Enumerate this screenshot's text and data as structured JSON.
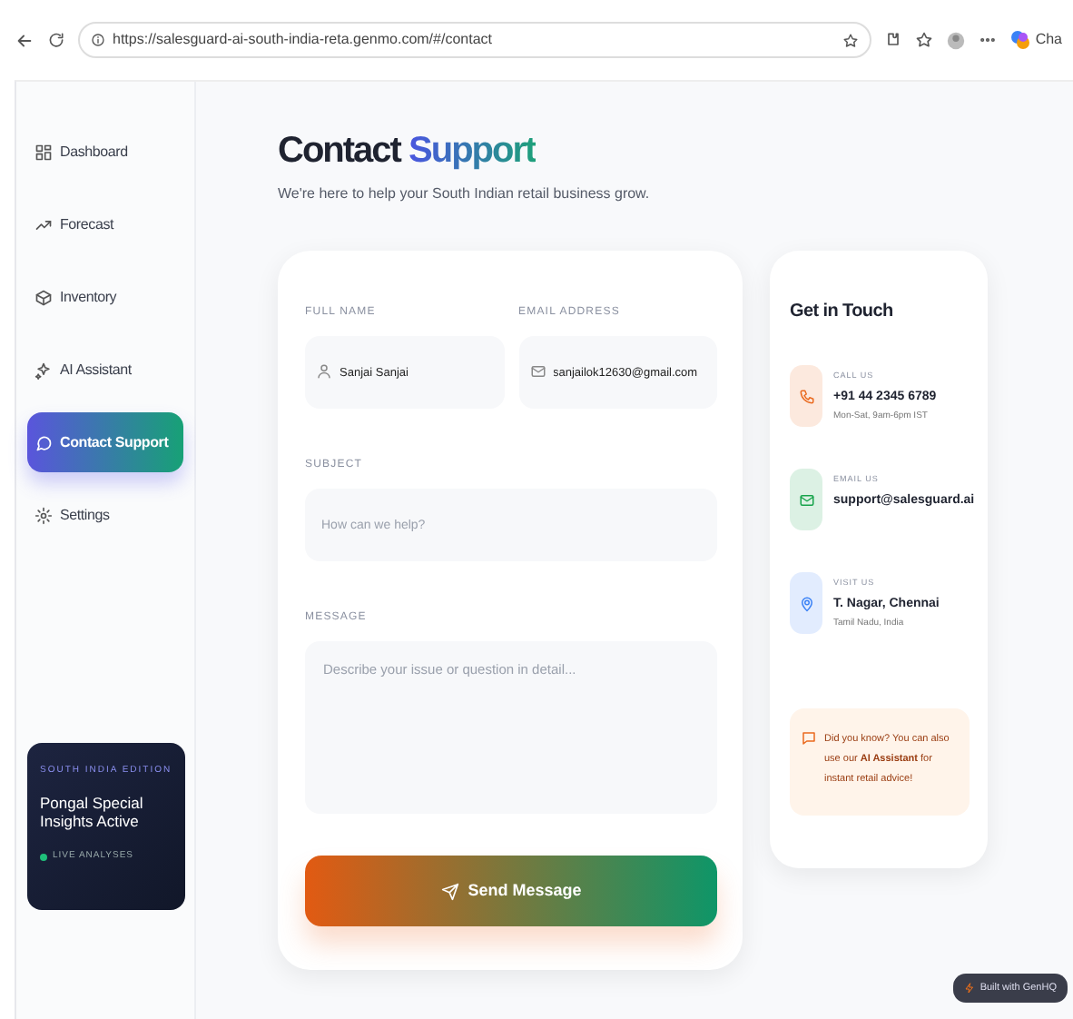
{
  "browser": {
    "url": "https://salesguard-ai-south-india-reta.genmo.com/#/contact",
    "edge_label": "Cha"
  },
  "sidebar": {
    "items": [
      {
        "label": "Dashboard",
        "selected": false
      },
      {
        "label": "Forecast",
        "selected": false
      },
      {
        "label": "Inventory",
        "selected": false
      },
      {
        "label": "AI Assistant",
        "selected": false
      },
      {
        "label": "Contact Support",
        "selected": true
      },
      {
        "label": "Settings",
        "selected": false
      }
    ],
    "promo": {
      "edition": "SOUTH INDIA EDITION",
      "title": "Pongal Special Insights Active",
      "status": "LIVE ANALYSES"
    }
  },
  "header": {
    "title": "Contact",
    "title_accent": "Support",
    "subtitle": "We're here to help your South Indian retail business grow."
  },
  "form": {
    "fields": [
      {
        "label": "FULL NAME",
        "kind": "input",
        "value": "Sanjai Sanjai"
      },
      {
        "label": "EMAIL ADDRESS",
        "kind": "input",
        "value": "sanjailok12630@gmail.com"
      },
      {
        "label": "SUBJECT",
        "kind": "input",
        "placeholder": "How can we help?"
      },
      {
        "label": "MESSAGE",
        "kind": "textarea",
        "placeholder": "Describe your issue or question in detail..."
      }
    ],
    "submit": "Send Message"
  },
  "contact": {
    "title": "Get in Touch",
    "items": [
      {
        "label": "CALL US",
        "value": "+91 44 2345 6789",
        "note": "Mon-Sat, 9am-6pm IST",
        "color": "#ea6a1f"
      },
      {
        "label": "EMAIL US",
        "value": "support@salesguard.ai",
        "color": "#16a34a"
      },
      {
        "label": "VISIT US",
        "value": "T. Nagar, Chennai",
        "note": "Tamil Nadu, India",
        "color": "#3b82f6"
      }
    ],
    "tip": "Did you know? You can also use our **AI Assistant** for instant retail advice!"
  },
  "badge": "Built with GenHQ"
}
